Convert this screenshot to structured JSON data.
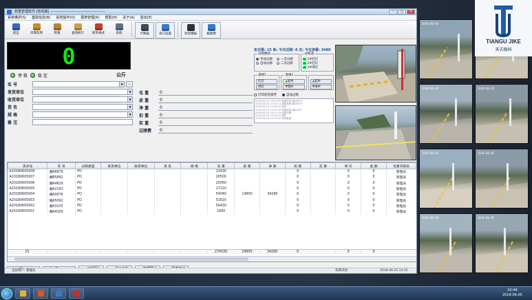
{
  "window": {
    "title": "称重管理软件 [有线版] ————————————————"
  },
  "menu": [
    "系统维护(S)",
    "基础信息(B)",
    "系统操作(O)",
    "报表管理(R)",
    "帮助(H)",
    "关于(A)",
    "退出(E)"
  ],
  "toolbar": [
    {
      "label": "退出",
      "icon": "exit-icon",
      "color": "#2d6cc0"
    },
    {
      "label": "日期车牌",
      "icon": "calendar-icon",
      "color": "#d08a2a"
    },
    {
      "label": "称重",
      "icon": "scale-icon",
      "color": "#c08030"
    },
    {
      "label": "查询统计",
      "icon": "chart-icon",
      "color": "#d0a040"
    },
    {
      "label": "磅单格式",
      "icon": "tools-icon",
      "color": "#c04030"
    },
    {
      "label": "系统",
      "icon": "gear-icon",
      "color": "#607090"
    },
    {
      "label": "计算器",
      "icon": "calculator-icon",
      "color": "#404a58"
    },
    {
      "label": "串口设置",
      "icon": "serial-icon",
      "color": "#3a78c8"
    },
    {
      "label": "语音播报",
      "icon": "speaker-icon",
      "color": "#333"
    },
    {
      "label": "截图像",
      "icon": "camera-icon",
      "color": "#3a78c8"
    }
  ],
  "weight": {
    "value": "0",
    "unit": "公斤",
    "stable_label": "稳 定",
    "power_label": "停 稳"
  },
  "form_left": [
    {
      "label": "车 号",
      "value": "",
      "has_dots": true
    },
    {
      "label": "发货单位",
      "value": ""
    },
    {
      "label": "收货单位",
      "value": ""
    },
    {
      "label": "货 名",
      "value": ""
    },
    {
      "label": "规 格",
      "value": ""
    },
    {
      "label": "备 注",
      "value": ""
    }
  ],
  "form_right": [
    {
      "label": "毛 重",
      "value": "0"
    },
    {
      "label": "皮 重",
      "value": "0"
    },
    {
      "label": "净 重",
      "value": "0"
    },
    {
      "label": "扣 重",
      "value": "0"
    },
    {
      "label": "实 重",
      "value": "0"
    },
    {
      "label": "过磅费",
      "value": "0"
    }
  ],
  "status_panel": {
    "header": "车记录: 15 条; 今日过磅: 8 次; 今日净重: 3480",
    "mode_group": "过磅模式",
    "modes": [
      "手动过磅",
      "一次过磅",
      "自动过磅",
      "二次过磅"
    ],
    "cam_group": "过磅道",
    "lights": [
      {
        "label": "1#红灯",
        "color": "#27a12b"
      },
      {
        "label": "2#红灯",
        "color": "#27a12b"
      },
      {
        "label": "3#绿灯",
        "color": "#27a12b"
      }
    ],
    "gate_group1": "道闸1",
    "gate_group2": "道闸2",
    "btn_up": "起杆",
    "btn_down": "落杆",
    "btn_red": "红灯",
    "btn_green": "绿灯",
    "check1": "打印前先保存",
    "check2": "自动过磅",
    "log": [
      "2018-06-25 14:32:05 称重完成 湘A6879",
      "2018-06-25 14:30:11 读取车牌 湘A6879",
      "2018-06-25 14:28:02 抬杆",
      "2018-06-25 14:25:40 称重完成 湘A5872",
      "2018-06-25 14:21:19 读取车牌",
      "2018-06-25 14:18:33 落杆",
      "2018-06-25 14:15:05 系统就绪"
    ]
  },
  "table": {
    "columns": [
      "流水号",
      "车 号",
      "过磅类型",
      "发货单位",
      "收货单位",
      "货 名",
      "规 格",
      "毛 重",
      "皮 重",
      "净 重",
      "扣 重",
      "实 重",
      "单 价",
      "金 额",
      "毛重司磅员"
    ],
    "rows": [
      [
        "A20180605008",
        "湘A6879",
        "PO",
        "",
        "",
        "",
        "",
        "13430",
        "",
        "",
        "0",
        "",
        "0",
        "0",
        "管理员"
      ],
      [
        "A20180605007",
        "湘B5892",
        "PO",
        "",
        "",
        "",
        "",
        "20500",
        "",
        "",
        "0",
        "",
        "0",
        "0",
        "管理员"
      ],
      [
        "A20180605006",
        "湘A4829",
        "PO",
        "",
        "",
        "",
        "",
        "20050",
        "",
        "",
        "0",
        "",
        "0",
        "0",
        "管理员"
      ],
      [
        "A20180605005",
        "湘A2193",
        "PO",
        "",
        "",
        "",
        "",
        "17210",
        "",
        "",
        "0",
        "",
        "0",
        "0",
        "管理员"
      ],
      [
        "A20180605004",
        "湘A0676",
        "PO",
        "",
        "",
        "",
        "",
        "54040",
        "19850",
        "34290",
        "0",
        "",
        "0",
        "0",
        "管理员"
      ],
      [
        "A20180605003",
        "湘A5092",
        "PO",
        "",
        "",
        "",
        "",
        "51610",
        "",
        "",
        "0",
        "",
        "0",
        "0",
        "管理员"
      ],
      [
        "A20180605002",
        "湘A3235",
        "PO",
        "",
        "",
        "",
        "",
        "50430",
        "",
        "",
        "0",
        "",
        "0",
        "0",
        "管理员"
      ],
      [
        "A20180605001",
        "湘A4209",
        "PO",
        "",
        "",
        "",
        "",
        "1660",
        "",
        "",
        "0",
        "",
        "0",
        "0",
        "管理员"
      ]
    ],
    "totals": [
      "15",
      "",
      "",
      "",
      "",
      "",
      "",
      "274530",
      "19850",
      "34290",
      "0",
      "",
      "0",
      "0",
      ""
    ]
  },
  "bottom": {
    "sel1": "未完记录",
    "sel2": "全部记录",
    "b1": "过磅图片",
    "b2": "显示面板",
    "b3": "数据导出",
    "b4": "报表打印"
  },
  "statusbar": {
    "user": "当前用户: 管理员",
    "center": "车牌识别",
    "time": "2018-06-25 14:35"
  },
  "camgrid": {
    "stamps": [
      "2018-06-05",
      "2018-06-05",
      "2018-06-05",
      "2018-06-05",
      "2018-06-05",
      "2018-06-05",
      "2018-06-05",
      "2018-06-05"
    ]
  },
  "logo": {
    "name": "TIANGU JIKE",
    "sub": "天古极科"
  },
  "clock": {
    "time": "10:44",
    "date": "2018-06-05"
  }
}
